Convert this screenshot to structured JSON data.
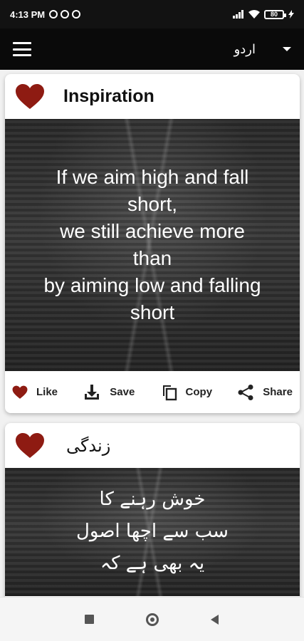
{
  "status_bar": {
    "time": "4:13 PM",
    "battery": "80"
  },
  "app_bar": {
    "language": "اردو"
  },
  "colors": {
    "heart": "#8e1b12",
    "app_bar": "#0a0a0a"
  },
  "cards": [
    {
      "title": "Inspiration",
      "quote": "If we aim high and fall\nshort,\nwe still achieve more\nthan\nby aiming low and falling\nshort",
      "actions": {
        "like": "Like",
        "save": "Save",
        "copy": "Copy",
        "share": "Share"
      }
    },
    {
      "title": "زندگی",
      "quote": "خوش رہنے کا\nسب سے اچھا اصول\nیہ بھی ہے کہ"
    }
  ],
  "icons": [
    "menu-icon",
    "dropdown-icon",
    "heart-icon",
    "download-icon",
    "copy-icon",
    "share-icon"
  ]
}
